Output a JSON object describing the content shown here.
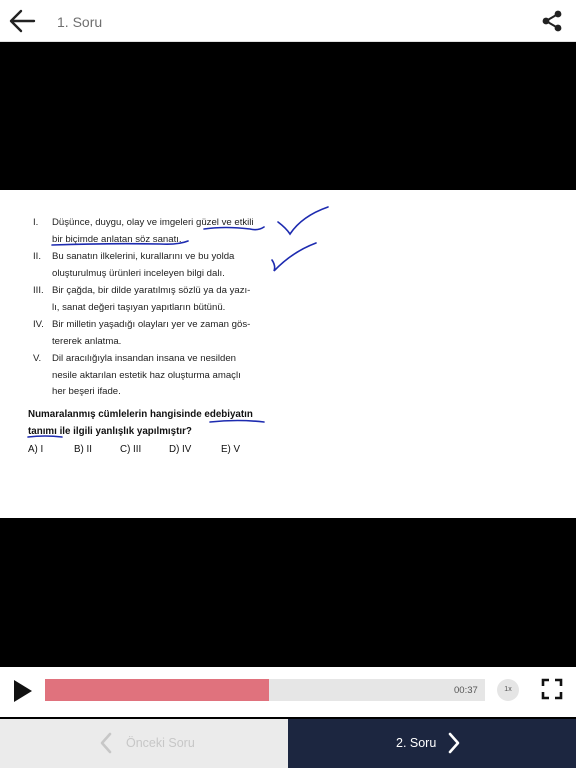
{
  "header": {
    "title": "1. Soru",
    "back_icon": "arrow-left-icon",
    "share_icon": "share-icon"
  },
  "question": {
    "items": [
      {
        "num": "I.",
        "lines": [
          "Düşünce, duygu, olay ve imgeleri güzel ve etkili",
          "bir biçimde anlatan söz sanatı."
        ]
      },
      {
        "num": "II.",
        "lines": [
          "Bu sanatın ilkelerini, kurallarını ve bu yolda",
          "oluşturulmuş ürünleri inceleyen bilgi dalı."
        ]
      },
      {
        "num": "III.",
        "lines": [
          "Bir çağda, bir dilde yaratılmış sözlü ya da yazı-",
          "lı, sanat değeri taşıyan yapıtların bütünü."
        ]
      },
      {
        "num": "IV.",
        "lines": [
          "Bir milletin yaşadığı olayları yer ve zaman gös-",
          "tererek anlatma."
        ]
      },
      {
        "num": "V.",
        "lines": [
          "Dil aracılığıyla insandan insana ve nesilden",
          "nesile aktarılan estetik haz oluşturma amaçlı",
          "her beşeri ifade."
        ]
      }
    ],
    "stem_lines": [
      "Numaralanmış cümlelerin hangisinde edebiyatın",
      "tanımı ile ilgili yanlışlık yapılmıştır?"
    ],
    "choices": [
      "A) I",
      "B) II",
      "C) III",
      "D) IV",
      "E) V"
    ],
    "ink_color": "#1d2bb0"
  },
  "player": {
    "progress": 0.51,
    "time": "00:37",
    "speed": "1x",
    "fill_color": "#e0727d"
  },
  "footer": {
    "prev_label": "Önceki Soru",
    "next_label": "2. Soru"
  }
}
